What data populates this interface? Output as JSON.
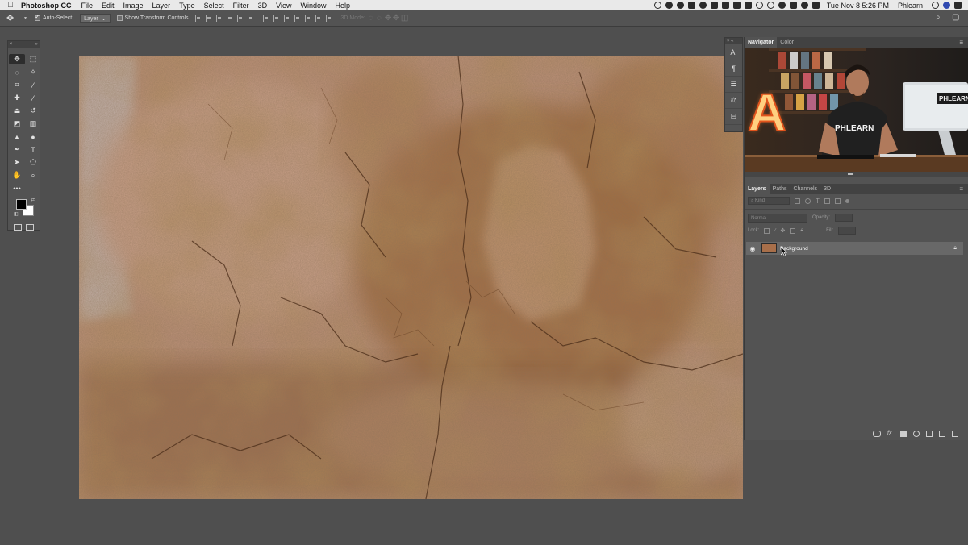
{
  "menubar": {
    "app_name": "Photoshop CC",
    "items": [
      "File",
      "Edit",
      "Image",
      "Layer",
      "Type",
      "Select",
      "Filter",
      "3D",
      "View",
      "Window",
      "Help"
    ],
    "clock": "Tue Nov 8  5:26 PM",
    "user": "Phlearn"
  },
  "options": {
    "auto_select_label": "Auto-Select:",
    "auto_select_checked": true,
    "auto_select_target": "Layer",
    "transform_label": "Show Transform Controls",
    "mode_3d_label": "3D Mode:"
  },
  "panels": {
    "navigator_tab": "Navigator",
    "color_tab": "Color",
    "layers_tabs": [
      "Layers",
      "Paths",
      "Channels",
      "3D"
    ],
    "search_placeholder": "Kind",
    "blend_mode": "Normal",
    "opacity_label": "Opacity:",
    "lock_label": "Lock:",
    "fill_label": "Fill:"
  },
  "layers": [
    {
      "name": "Background",
      "visible": true,
      "locked": true
    }
  ],
  "video": {
    "shirt_text": "PHLEARN",
    "monitor_text": "PHLEARN",
    "sign_letter": "A"
  }
}
